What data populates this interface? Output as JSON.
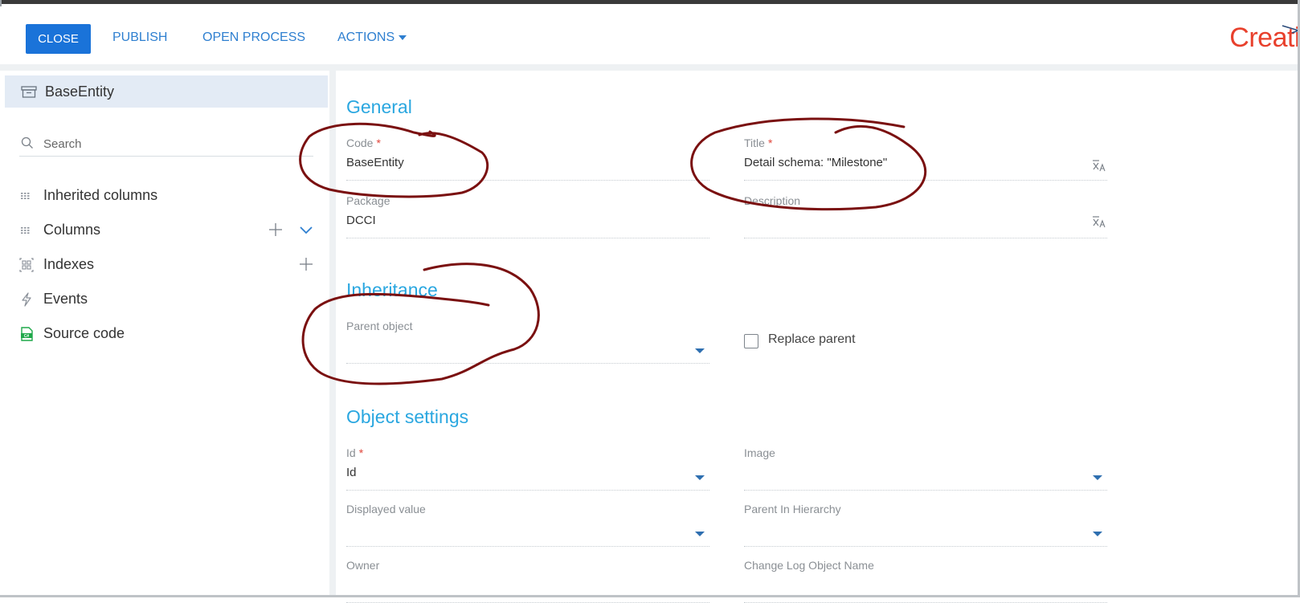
{
  "toolbar": {
    "close_label": "CLOSE",
    "publish_label": "PUBLISH",
    "open_process_label": "OPEN PROCESS",
    "actions_label": "ACTIONS"
  },
  "brand": {
    "logo_text": "Creati"
  },
  "sidebar": {
    "entity_name": "BaseEntity",
    "search_placeholder": "Search",
    "items": [
      {
        "label": "Inherited columns",
        "icon": "columns-icon"
      },
      {
        "label": "Columns",
        "icon": "columns-icon"
      },
      {
        "label": "Indexes",
        "icon": "index-icon"
      },
      {
        "label": "Events",
        "icon": "lightning-icon"
      },
      {
        "label": "Source code",
        "icon": "csharp-file-icon"
      }
    ]
  },
  "general": {
    "title": "General",
    "code": {
      "label": "Code",
      "value": "BaseEntity",
      "required": "*"
    },
    "title_field": {
      "label": "Title",
      "value": "Detail schema: \"Milestone\"",
      "required": "*"
    },
    "package": {
      "label": "Package",
      "value": "DCCI"
    },
    "description": {
      "label": "Description",
      "value": ""
    }
  },
  "inheritance": {
    "title": "Inheritance",
    "parent_object": {
      "label": "Parent object",
      "value": ""
    },
    "replace_parent": {
      "label": "Replace parent",
      "checked": false
    }
  },
  "object_settings": {
    "title": "Object settings",
    "id": {
      "label": "Id",
      "value": "Id",
      "required": "*"
    },
    "image": {
      "label": "Image",
      "value": ""
    },
    "displayed_value": {
      "label": "Displayed value",
      "value": ""
    },
    "parent_in_hierarchy": {
      "label": "Parent In Hierarchy",
      "value": ""
    },
    "owner": {
      "label": "Owner",
      "value": ""
    },
    "change_log_object_name": {
      "label": "Change Log Object Name",
      "value": ""
    }
  },
  "colors": {
    "primary_button": "#1a73d9",
    "link": "#2e7fd0",
    "section_title": "#2aa7e0",
    "required": "#e0473c",
    "logo": "#e8402c",
    "annotation": "#7a1010"
  }
}
